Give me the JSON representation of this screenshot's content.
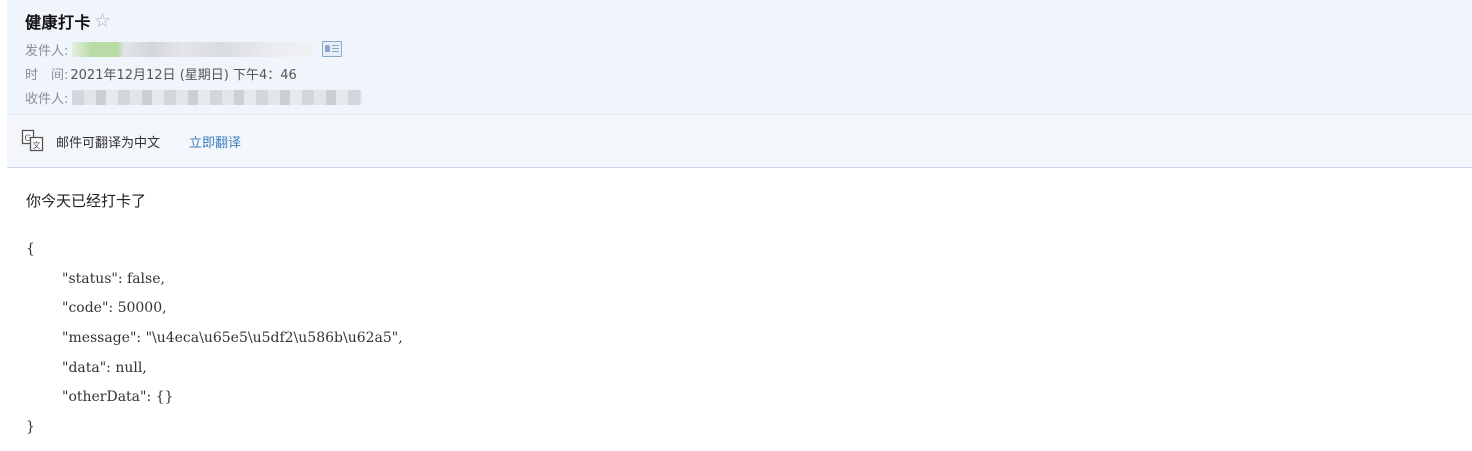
{
  "email": {
    "subject": "健康打卡",
    "star_icon": "star-outline-icon",
    "from_label": "发件人:",
    "time_label": "时　间:",
    "time_value": "2021年12月12日 (星期日) 下午4：46",
    "to_label": "收件人:",
    "contact_icon": "contact-card-icon"
  },
  "translate": {
    "icon": "translate-icon",
    "message": "邮件可翻译为中文",
    "action": "立即翻译"
  },
  "body": {
    "greeting": "你今天已经打卡了",
    "json_lines": [
      "{",
      "\"status\": false,",
      "\"code\": 50000,",
      "\"message\": \"\\u4eca\\u65e5\\u5df2\\u586b\\u62a5\",",
      "\"data\": null,",
      "\"otherData\": {}",
      "}"
    ]
  },
  "colors": {
    "header_bg": "#f0f4fb",
    "link": "#3d7fc1"
  }
}
